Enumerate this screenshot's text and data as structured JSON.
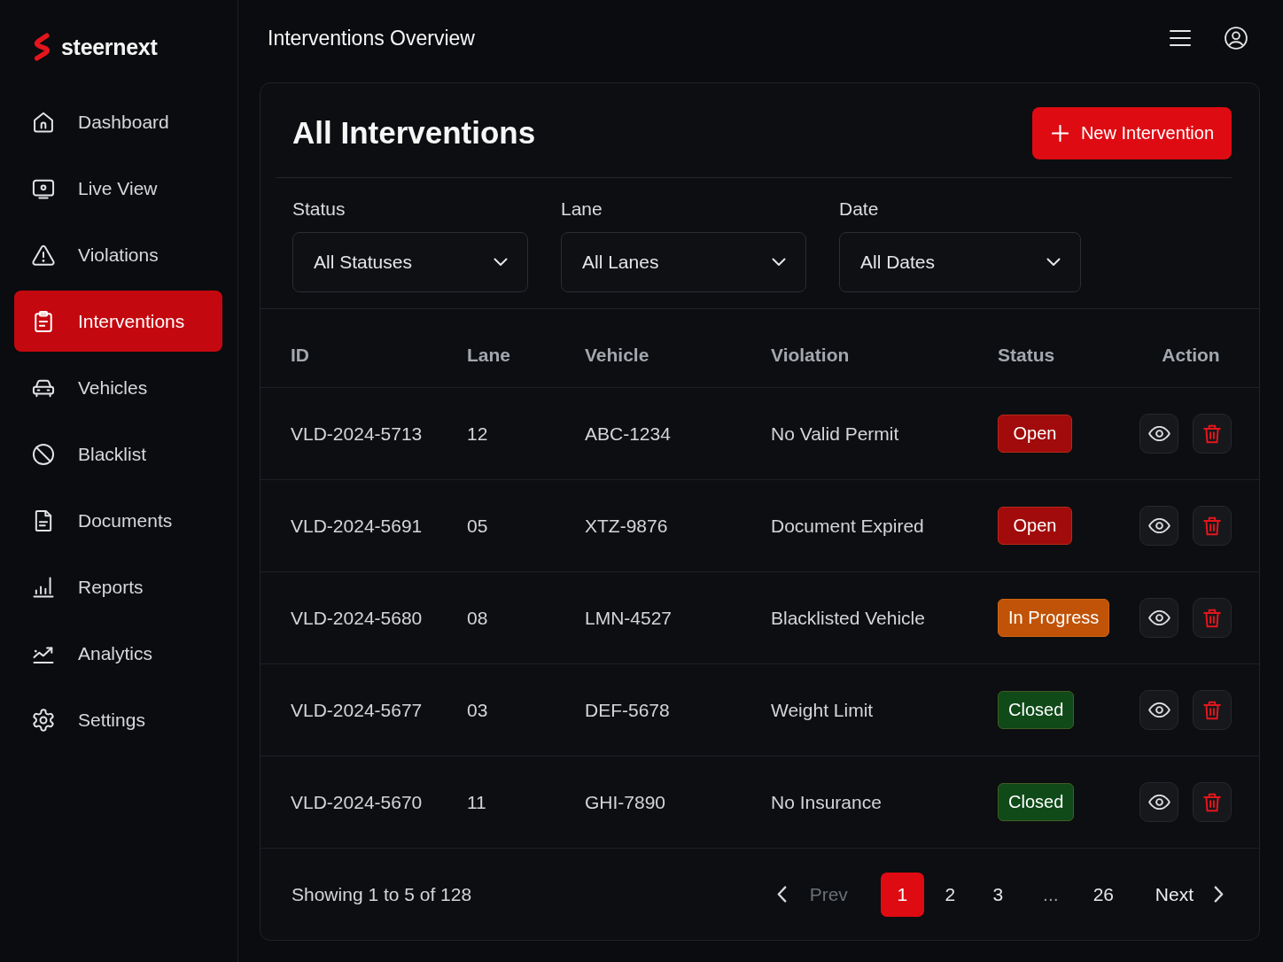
{
  "sidebar": {
    "brand": "steernext",
    "items": [
      {
        "label": "Dashboard",
        "selected": false
      },
      {
        "label": "Live View",
        "selected": false
      },
      {
        "label": "Violations",
        "selected": false
      },
      {
        "label": "Interventions",
        "selected": true
      },
      {
        "label": "Vehicles",
        "selected": false
      },
      {
        "label": "Blacklist",
        "selected": false
      },
      {
        "label": "Documents",
        "selected": false
      },
      {
        "label": "Reports",
        "selected": false
      },
      {
        "label": "Analytics",
        "selected": false
      },
      {
        "label": "Settings",
        "selected": false
      }
    ]
  },
  "header": {
    "title": "Interventions Overview"
  },
  "card": {
    "title": "All Interventions",
    "new_button": "New Intervention",
    "filters": [
      {
        "label": "Status",
        "value": "All Statuses"
      },
      {
        "label": "Lane",
        "value": "All Lanes"
      },
      {
        "label": "Date",
        "value": "All Dates"
      }
    ],
    "table": {
      "columns": [
        "ID",
        "Lane",
        "Vehicle",
        "Violation",
        "Status",
        "Action"
      ],
      "rows": [
        {
          "id": "VLD-2024-5713",
          "lane": "12",
          "vehicle": "ABC-1234",
          "violation": "No Valid Permit",
          "status": {
            "label": "Open",
            "color": "#a10b0b"
          }
        },
        {
          "id": "VLD-2024-5691",
          "lane": "05",
          "vehicle": "XTZ-9876",
          "violation": "Document Expired",
          "status": {
            "label": "Open",
            "color": "#a10b0b"
          }
        },
        {
          "id": "VLD-2024-5680",
          "lane": "08",
          "vehicle": "LMN-4527",
          "violation": "Blacklisted Vehicle",
          "status": {
            "label": "In Progress",
            "color": "#c05307"
          }
        },
        {
          "id": "VLD-2024-5677",
          "lane": "03",
          "vehicle": "DEF-5678",
          "violation": "Weight Limit",
          "status": {
            "label": "Closed",
            "color": "#0f4a18"
          }
        },
        {
          "id": "VLD-2024-5670",
          "lane": "11",
          "vehicle": "GHI-7890",
          "violation": "No Insurance",
          "status": {
            "label": "Closed",
            "color": "#0f4a18"
          }
        }
      ]
    },
    "footer": {
      "summary": "Showing 1 to 5 of 128",
      "pagination": {
        "prev": {
          "label": "Prev",
          "disabled": true
        },
        "pages": [
          {
            "kind": "page",
            "label": "1",
            "selected": true
          },
          {
            "kind": "page",
            "label": "2",
            "selected": false
          },
          {
            "kind": "page",
            "label": "3",
            "selected": false
          },
          {
            "kind": "gap",
            "label": "...",
            "selected": false
          },
          {
            "kind": "page",
            "label": "26",
            "selected": false
          }
        ],
        "next": {
          "label": "Next",
          "disabled": false
        }
      }
    }
  }
}
